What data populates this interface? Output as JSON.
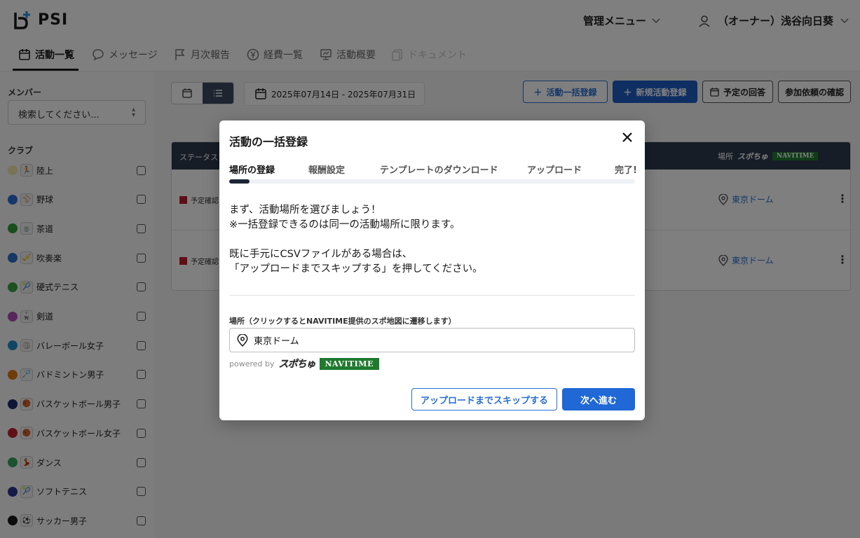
{
  "header": {
    "logo_text": "PSI",
    "admin_menu": "管理メニュー",
    "user_name": "（オーナー）浅谷向日葵"
  },
  "tabs": [
    {
      "label": "活動一覧",
      "state": "active"
    },
    {
      "label": "メッセージ",
      "state": "normal"
    },
    {
      "label": "月次報告",
      "state": "normal"
    },
    {
      "label": "経費一覧",
      "state": "normal"
    },
    {
      "label": "活動概要",
      "state": "normal"
    },
    {
      "label": "ドキュメント",
      "state": "disabled"
    }
  ],
  "sidebar": {
    "member_label": "メンバー",
    "member_search_placeholder": "検索してください...",
    "club_label": "クラブ",
    "clubs": [
      {
        "name": "陸上",
        "color": "#f0e8a8",
        "icon": "🏃"
      },
      {
        "name": "野球",
        "color": "#2f6fd6",
        "icon": "⚾"
      },
      {
        "name": "茶道",
        "color": "#2f9e3a",
        "icon": "🍵"
      },
      {
        "name": "吹奏楽",
        "color": "#2a72c9",
        "icon": "🎺"
      },
      {
        "name": "硬式テニス",
        "color": "#3aa53d",
        "icon": "🎾"
      },
      {
        "name": "剣道",
        "color": "#b04fb8",
        "icon": "🥋"
      },
      {
        "name": "バレーボール女子",
        "color": "#1f8fc9",
        "icon": "🏐"
      },
      {
        "name": "バドミントン男子",
        "color": "#e07a14",
        "icon": "🏸"
      },
      {
        "name": "バスケットボール男子",
        "color": "#1c2a6b",
        "icon": "🏀"
      },
      {
        "name": "バスケットボール女子",
        "color": "#c42030",
        "icon": "🏀"
      },
      {
        "name": "ダンス",
        "color": "#36a760",
        "icon": "💃"
      },
      {
        "name": "ソフトテニス",
        "color": "#2a3590",
        "icon": "🎾"
      },
      {
        "name": "サッカー男子",
        "color": "#1a1a1a",
        "icon": "⚽"
      }
    ]
  },
  "main": {
    "date_range": "2025年07月14日 - 2025年07月31日",
    "buttons": {
      "bulk_register": "活動一括登録",
      "new_activity": "新規活動登録",
      "schedule_answer": "予定の回答",
      "participation_check": "参加依頼の確認"
    },
    "table": {
      "col_status": "ステータス",
      "col_place": "場所",
      "place_brand": "スポちゅ",
      "navitime": "NAVITIME",
      "rows": [
        {
          "status": "予定確認",
          "place": "東京ドーム"
        },
        {
          "status": "予定確認",
          "place": "東京ドーム"
        }
      ]
    }
  },
  "modal": {
    "title": "活動の一括登録",
    "steps": [
      "場所の登録",
      "報酬設定",
      "テンプレートのダウンロード",
      "アップロード",
      "完了!"
    ],
    "current_step": 0,
    "progress": 0.05,
    "body_lines": [
      "まず、活動場所を選びましょう！",
      "※一括登録できるのは同一の活動場所に限ります。",
      "",
      "既に手元にCSVファイルがある場合は、",
      "「アップロードまでスキップする」を押してください。"
    ],
    "field_label": "場所（クリックするとNAVITIME提供のスポ地図に遷移します）",
    "field_value": "東京ドーム",
    "powered_by": "powered by",
    "supo_logo": "スポちゅ",
    "navitime_logo": "NAVITIME",
    "skip_button": "アップロードまでスキップする",
    "next_button": "次へ進む"
  }
}
